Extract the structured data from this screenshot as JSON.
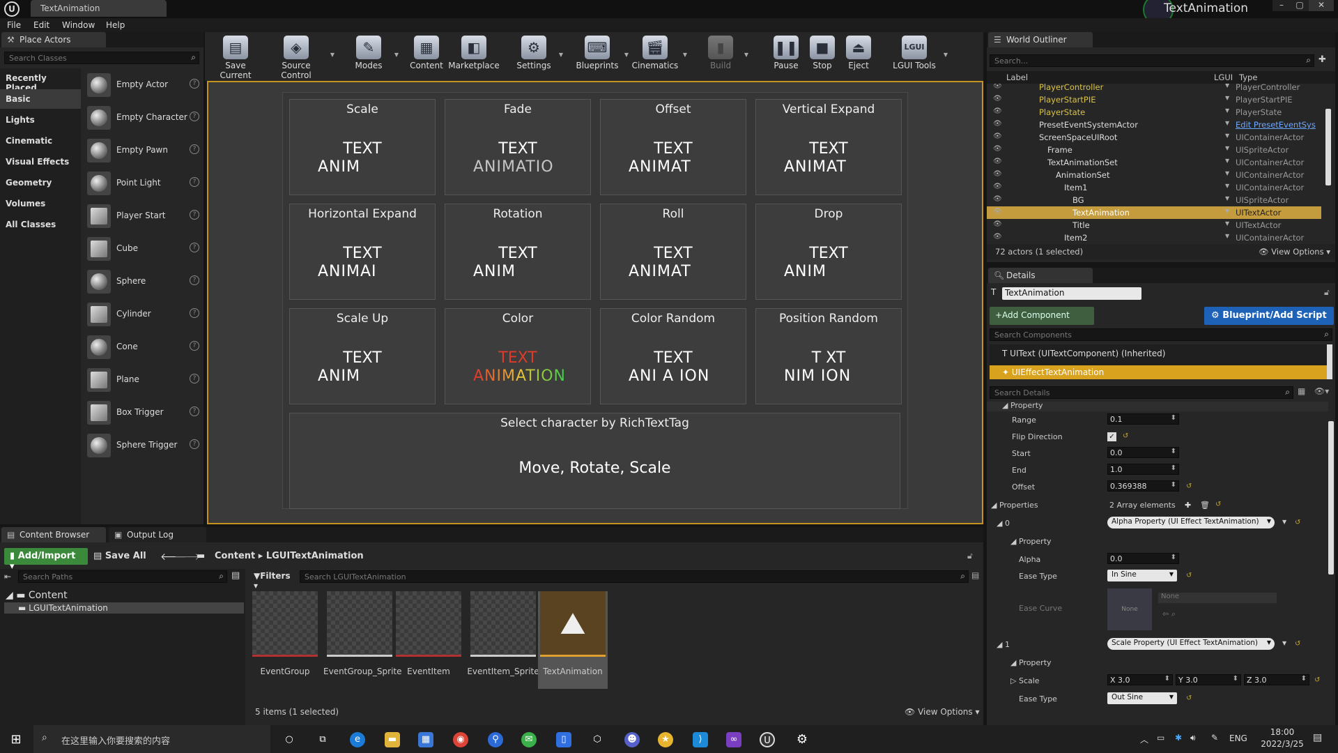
{
  "window": {
    "tab_title": "TextAnimation",
    "project_name": "TextAnimation",
    "logo": "U"
  },
  "menu": [
    "File",
    "Edit",
    "Window",
    "Help"
  ],
  "place_actors": {
    "tab": "Place Actors",
    "search_placeholder": "Search Classes",
    "categories": [
      "Recently Placed",
      "Basic",
      "Lights",
      "Cinematic",
      "Visual Effects",
      "Geometry",
      "Volumes",
      "All Classes"
    ],
    "selected_category": "Basic",
    "actors": [
      "Empty Actor",
      "Empty Character",
      "Empty Pawn",
      "Point Light",
      "Player Start",
      "Cube",
      "Sphere",
      "Cylinder",
      "Cone",
      "Plane",
      "Box Trigger",
      "Sphere Trigger"
    ]
  },
  "toolbar": [
    "Save Current",
    "Source Control",
    "Modes",
    "Content",
    "Marketplace",
    "Settings",
    "Blueprints",
    "Cinematics",
    "Build",
    "Pause",
    "Stop",
    "Eject",
    "LGUI Tools"
  ],
  "viewport": {
    "cells": [
      {
        "title": "Scale",
        "l1": "TEXT",
        "l2": "ANIM"
      },
      {
        "title": "Fade",
        "l1": "TEXT",
        "l2": "ANIMATIO"
      },
      {
        "title": "Offset",
        "l1": "TEXT",
        "l2": "ANIMAT"
      },
      {
        "title": "Vertical Expand",
        "l1": "TEXT",
        "l2": "ANIMAT"
      },
      {
        "title": "Horizontal Expand",
        "l1": "TEXT",
        "l2": "ANIMAI"
      },
      {
        "title": "Rotation",
        "l1": "TEXT",
        "l2": "ANIM"
      },
      {
        "title": "Roll",
        "l1": "TEXT",
        "l2": "ANIMAT"
      },
      {
        "title": "Drop",
        "l1": "TEXT",
        "l2": "ANIM"
      },
      {
        "title": "Scale Up",
        "l1": "TEXT",
        "l2": "ANIM"
      },
      {
        "title": "Color",
        "l1": "TEXT",
        "l2": "ANIMATION"
      },
      {
        "title": "Color Random",
        "l1": "TEXT",
        "l2": "ANI A ION"
      },
      {
        "title": "Position Random",
        "l1": "T XT",
        "l2": "NIM  ION"
      }
    ],
    "rich": {
      "title": "Select character by RichTextTag",
      "text": "Move, Rotate, Scale"
    }
  },
  "outliner": {
    "tab": "World Outliner",
    "search_placeholder": "Search...",
    "columns": [
      "Label",
      "LGUI",
      "Type"
    ],
    "rows": [
      {
        "name": "PlayerController",
        "type": "PlayerController",
        "indent": 2
      },
      {
        "name": "PlayerStartPIE",
        "type": "PlayerStartPIE",
        "indent": 2
      },
      {
        "name": "PlayerState",
        "type": "PlayerState",
        "indent": 2
      },
      {
        "name": "PresetEventSystemActor",
        "type": "Edit PresetEventSys",
        "indent": 2
      },
      {
        "name": "ScreenSpaceUIRoot",
        "type": "UIContainerActor",
        "indent": 1
      },
      {
        "name": "Frame",
        "type": "UISpriteActor",
        "indent": 3
      },
      {
        "name": "TextAnimationSet",
        "type": "UIContainerActor",
        "indent": 2
      },
      {
        "name": "AnimationSet",
        "type": "UIContainerActor",
        "indent": 3
      },
      {
        "name": "Item1",
        "type": "UIContainerActor",
        "indent": 4
      },
      {
        "name": "BG",
        "type": "UISpriteActor",
        "indent": 5
      },
      {
        "name": "TextAnimation",
        "type": "UITextActor",
        "indent": 5
      },
      {
        "name": "Title",
        "type": "UITextActor",
        "indent": 5
      },
      {
        "name": "Item2",
        "type": "UIContainerActor",
        "indent": 4
      }
    ],
    "selected": "TextAnimation",
    "footer": "72 actors (1 selected)",
    "view_options": "View Options"
  },
  "details": {
    "tab": "Details",
    "actor_name": "TextAnimation",
    "add_component": "+Add Component",
    "blueprint_btn": "Blueprint/Add Script",
    "search_components": "Search Components",
    "comp1": "UIText (UITextComponent) (Inherited)",
    "comp2": "UIEffectTextAnimation",
    "search_details": "Search Details",
    "property_header": "Property",
    "range_label": "Range",
    "range": "0.1",
    "flip_label": "Flip Direction",
    "start_label": "Start",
    "start": "0.0",
    "end_label": "End",
    "end": "1.0",
    "offset_label": "Offset",
    "offset": "0.369388",
    "properties_label": "Properties",
    "properties_count": "2 Array elements",
    "elem0": "0",
    "elem0_value": "Alpha Property (UI Effect TextAnimation)",
    "alpha_label": "Alpha",
    "alpha": "0.0",
    "ease_type_label": "Ease Type",
    "ease0": "In Sine",
    "ease_curve_label": "Ease Curve",
    "curve_none": "None",
    "curve_thumb": "None",
    "elem1": "1",
    "elem1_value": "Scale Property (UI Effect TextAnimation)",
    "scale_label": "Scale",
    "sx": "X 3.0",
    "sy": "Y 3.0",
    "sz": "Z 3.0",
    "ease1": "Out Sine"
  },
  "content_browser": {
    "tabs": [
      "Content Browser",
      "Output Log"
    ],
    "add_import": "Add/Import",
    "save_all": "Save All",
    "path": [
      "Content",
      "LGUITextAnimation"
    ],
    "search_paths": "Search Paths",
    "filters": "Filters",
    "search_assets": "Search LGUITextAnimation",
    "tree": [
      "Content",
      "LGUITextAnimation"
    ],
    "assets": [
      "EventGroup",
      "EventGroup_Sprite",
      "EventItem",
      "EventItem_Sprite",
      "TextAnimation"
    ],
    "footer": "5 items (1 selected)",
    "view_options": "View Options"
  },
  "taskbar": {
    "search_placeholder": "在这里输入你要搜索的内容",
    "lang": "ENG",
    "time": "18:00",
    "date": "2022/3/25"
  }
}
